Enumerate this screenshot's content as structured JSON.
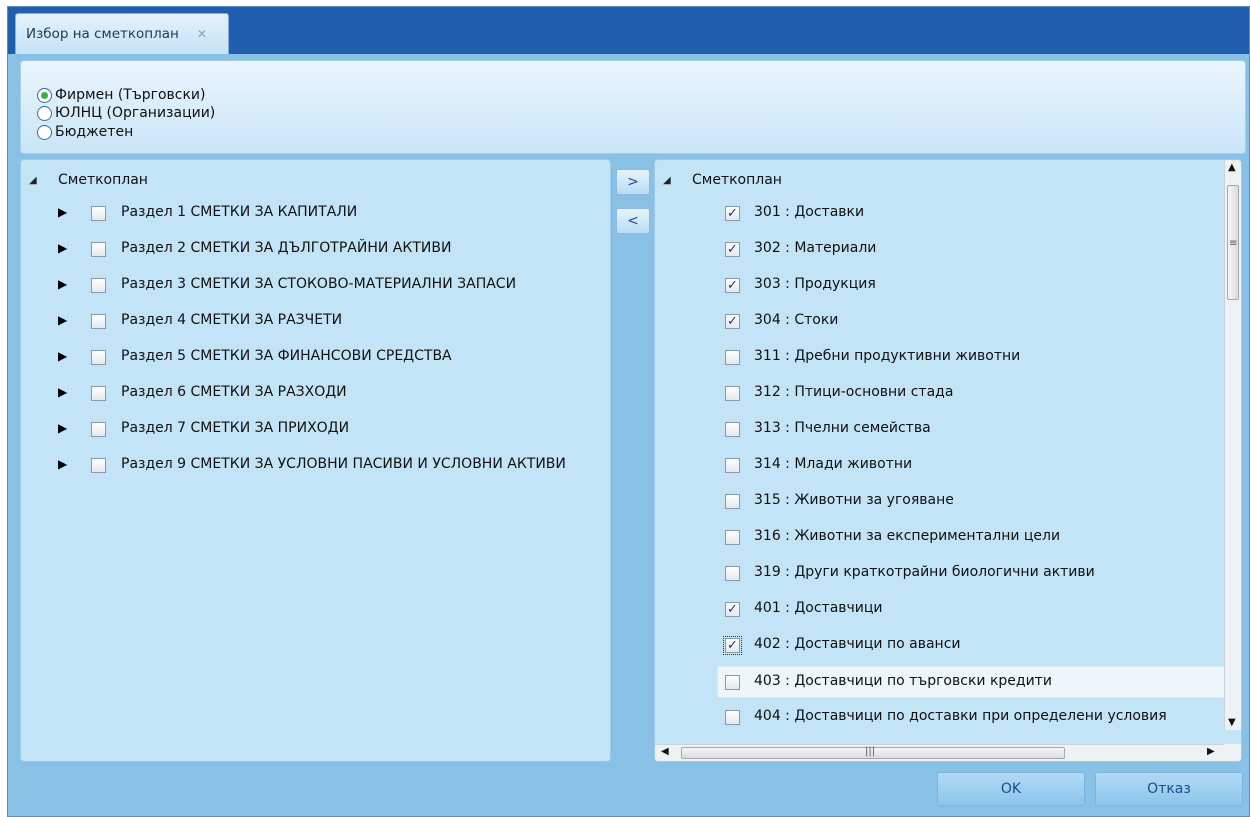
{
  "tab": {
    "title": "Избор на сметкоплан",
    "close_glyph": "✕"
  },
  "plan_types": [
    {
      "label": "Фирмен (Търговски)",
      "selected": true
    },
    {
      "label": "ЮЛНЦ (Организации)",
      "selected": false
    },
    {
      "label": "Бюджетен",
      "selected": false
    }
  ],
  "left_tree": {
    "root": "Сметкоплан",
    "items": [
      "Раздел 1 СМЕТКИ ЗА КАПИТАЛИ",
      "Раздел 2 СМЕТКИ ЗА ДЪЛГОТРАЙНИ АКТИВИ",
      "Раздел 3 СМЕТКИ ЗА СТОКОВО-МАТЕРИАЛНИ ЗАПАСИ",
      "Раздел 4 СМЕТКИ ЗА РАЗЧЕТИ",
      "Раздел 5 СМЕТКИ ЗА ФИНАНСОВИ СРЕДСТВА",
      "Раздел 6 СМЕТКИ ЗА РАЗХОДИ",
      "Раздел 7 СМЕТКИ ЗА ПРИХОДИ",
      "Раздел 9 СМЕТКИ ЗА УСЛОВНИ ПАСИВИ И УСЛОВНИ АКТИВИ"
    ]
  },
  "move_buttons": {
    "add": ">",
    "remove": "<"
  },
  "right_tree": {
    "root": "Сметкоплан",
    "items": [
      {
        "label": "301 : Доставки",
        "checked": true
      },
      {
        "label": "302 : Материали",
        "checked": true
      },
      {
        "label": "303 : Продукция",
        "checked": true
      },
      {
        "label": "304 : Стоки",
        "checked": true
      },
      {
        "label": "311 : Дребни продуктивни животни",
        "checked": false
      },
      {
        "label": "312 : Птици-основни стада",
        "checked": false
      },
      {
        "label": "313 : Пчелни семейства",
        "checked": false
      },
      {
        "label": "314 : Млади животни",
        "checked": false
      },
      {
        "label": "315 : Животни за угояване",
        "checked": false
      },
      {
        "label": "316 : Животни за експериментални цели",
        "checked": false
      },
      {
        "label": "319 : Други краткотрайни биологични активи",
        "checked": false
      },
      {
        "label": "401 : Доставчици",
        "checked": true
      },
      {
        "label": "402 : Доставчици по аванси",
        "checked": true,
        "focused": true
      },
      {
        "label": "403 : Доставчици по търговски кредити",
        "checked": false,
        "hovered": true
      },
      {
        "label": "404 : Доставчици по доставки при определени условия",
        "checked": false
      }
    ]
  },
  "buttons": {
    "ok": "OK",
    "cancel": "Отказ"
  },
  "colors": {
    "tab_bar": "#1f5fae",
    "window_bg": "#89c1e6",
    "panel_bg": "#c3e3f7",
    "radio_selected": "#3bb03b"
  }
}
